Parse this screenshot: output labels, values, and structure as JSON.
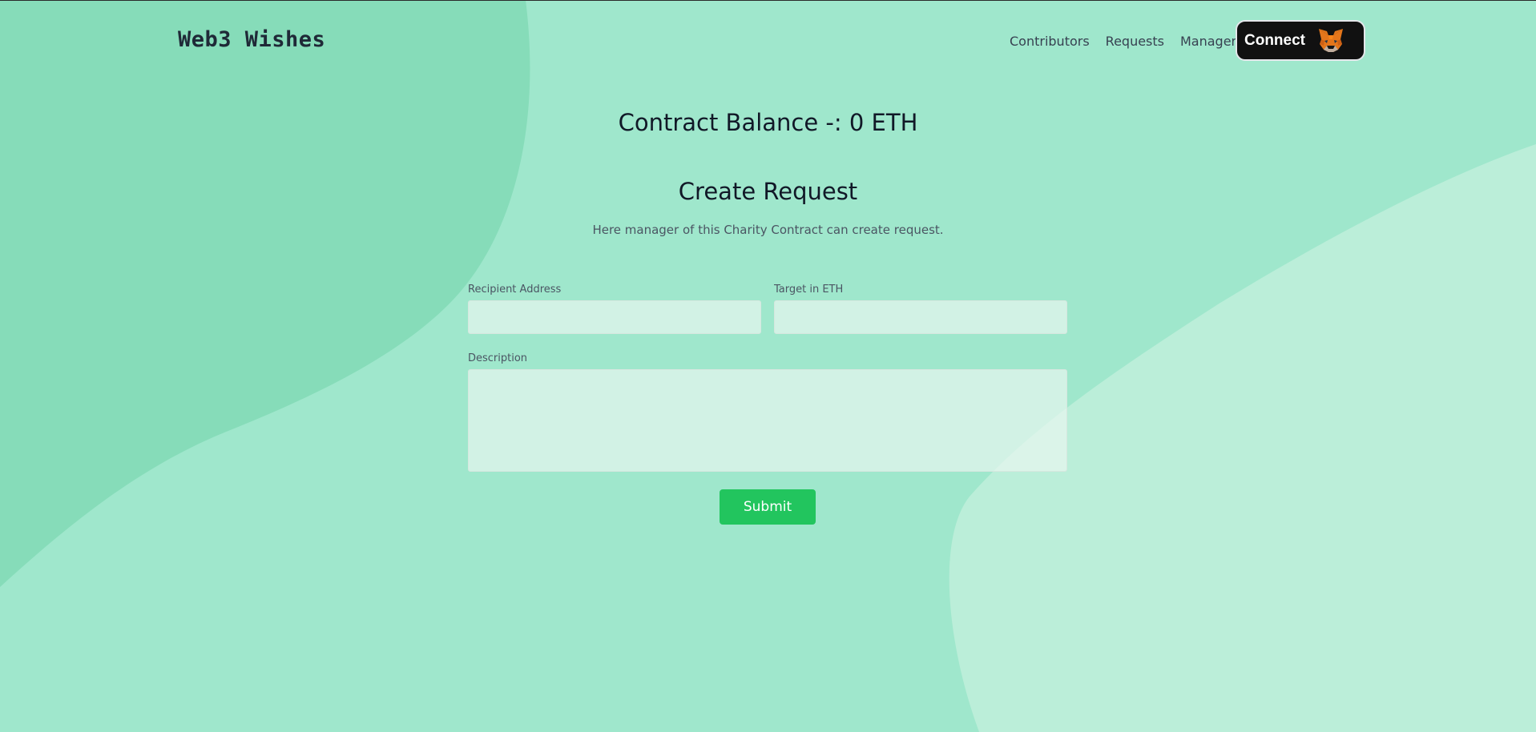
{
  "header": {
    "brand": "Web3 Wishes",
    "nav": [
      {
        "label": "Contributors"
      },
      {
        "label": "Requests"
      },
      {
        "label": "Manager"
      }
    ],
    "connect_label": "Connect",
    "connect_icon": "metamask-fox-icon"
  },
  "main": {
    "balance_text": "Contract Balance -: 0 ETH",
    "title": "Create Request",
    "subtitle": "Here manager of this Charity Contract can create request.",
    "form": {
      "recipient_label": "Recipient Address",
      "recipient_value": "",
      "target_label": "Target in ETH",
      "target_value": "",
      "description_label": "Description",
      "description_value": "",
      "submit_label": "Submit"
    }
  },
  "colors": {
    "background": "#9fe7cc",
    "blob_dark": "#86dcb9",
    "blob_light": "#bbeed9",
    "submit": "#22c55e",
    "connect_bg": "#111111"
  }
}
